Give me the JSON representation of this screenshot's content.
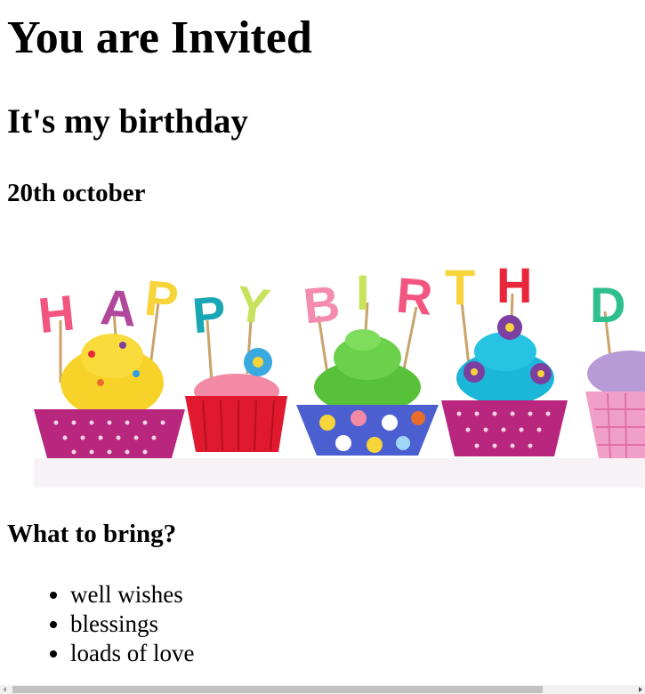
{
  "page": {
    "title": "You are Invited",
    "subtitle": "It's my birthday",
    "date": "20th october",
    "bring_heading": "What to bring?",
    "bring_items": [
      "well wishes",
      "blessings",
      "loads of love"
    ]
  },
  "banner": {
    "letters": [
      "H",
      "A",
      "P",
      "P",
      "Y",
      "B",
      "I",
      "R",
      "T",
      "H",
      "D"
    ],
    "colors": {
      "pink": "#f2557f",
      "purple": "#b0479c",
      "yellow": "#f6d43a",
      "teal": "#1aa7b5",
      "lime": "#c7e35c",
      "rose": "#f48cb0",
      "red": "#e8283a",
      "green": "#2fbf8f"
    }
  },
  "scrollbar": {
    "thumb_color": "#c1c1c1",
    "track_color": "#f1f1f1"
  }
}
